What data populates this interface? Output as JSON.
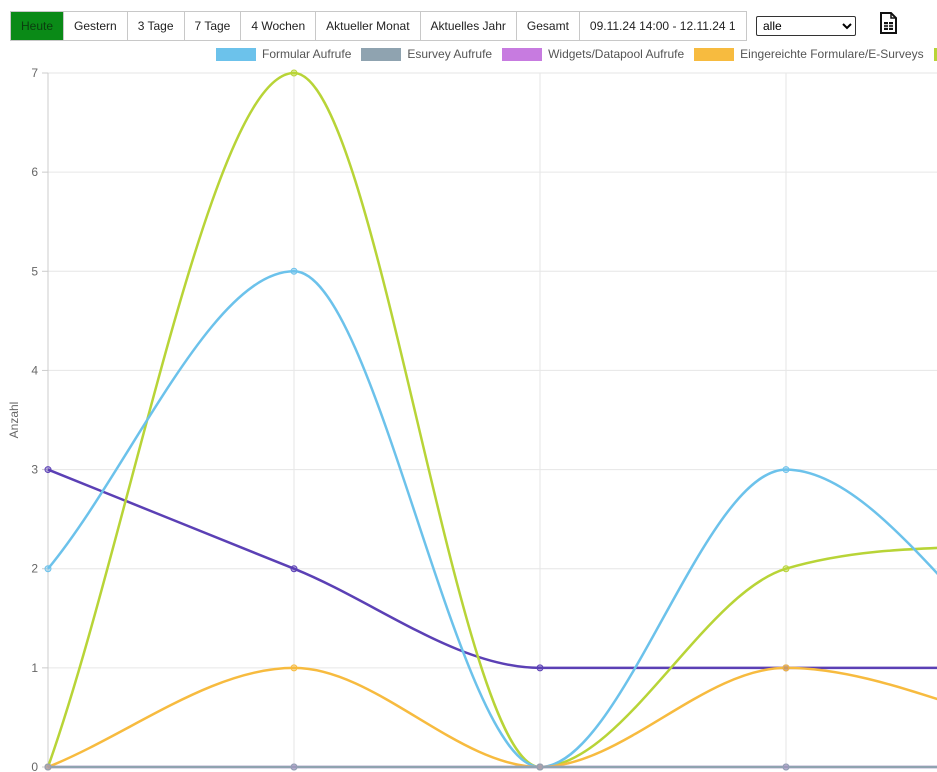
{
  "toolbar": {
    "buttons": [
      "Heute",
      "Gestern",
      "3 Tage",
      "7 Tage",
      "4 Wochen",
      "Aktueller Monat",
      "Aktuelles Jahr",
      "Gesamt",
      "09.11.24 14:00 - 12.11.24 1"
    ],
    "active_index": 0,
    "select_value": "alle",
    "export_icon": "spreadsheet-icon"
  },
  "colors": {
    "active_button": "#0a8a17",
    "formular": "#6cc2eb",
    "esurvey": "#8fa3b0",
    "widgets": "#c77be0",
    "eingereichte": "#f7bb3f",
    "green": "#b8d437",
    "purple": "#5b40b5"
  },
  "chart_data": {
    "type": "line",
    "ylabel": "Anzahl",
    "xlabel": "",
    "ylim": [
      0,
      7
    ],
    "yticks": [
      "0",
      "1",
      "2",
      "3",
      "4",
      "5",
      "6",
      "7"
    ],
    "grid": true,
    "legend_position": "top",
    "x": [
      0,
      1,
      2,
      3,
      4
    ],
    "series": [
      {
        "name": "Formular Aufrufe",
        "color": "#6cc2eb",
        "values": [
          2,
          5,
          0,
          3,
          1
        ],
        "in_legend": true
      },
      {
        "name": "Esurvey Aufrufe",
        "color": "#8fa3b0",
        "values": [
          0,
          0,
          0,
          0,
          0
        ],
        "in_legend": true
      },
      {
        "name": "Widgets/Datapool Aufrufe",
        "color": "#c77be0",
        "values": [
          0,
          0,
          0,
          0,
          0
        ],
        "in_legend": true
      },
      {
        "name": "Eingereichte Formulare/E-Surveys",
        "color": "#f7bb3f",
        "values": [
          0,
          1,
          0,
          1,
          0.4
        ],
        "in_legend": true
      },
      {
        "name": "",
        "color": "#b8d437",
        "values": [
          0,
          7,
          0,
          2,
          2.25
        ],
        "in_legend": true
      },
      {
        "name": "",
        "color": "#5b40b5",
        "values": [
          3,
          2,
          1,
          1,
          1
        ],
        "in_legend": false
      }
    ]
  }
}
